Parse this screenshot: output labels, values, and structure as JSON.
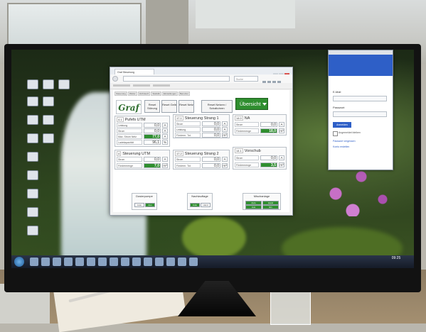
{
  "browser": {
    "tab_title": "Graf Steuerung",
    "url": "",
    "search_placeholder": "Suche"
  },
  "app": {
    "subnav": [
      "Steuerung",
      "Wetter",
      "Verbrauch",
      "Statistik",
      "Einstellungen",
      "Benutzer"
    ],
    "logo": "Graf",
    "header_buttons": [
      {
        "label": "Reset Störung"
      },
      {
        "label": "Reset Gelb"
      },
      {
        "label": "Reset Netz"
      },
      {
        "label": "Reset Netzen / Schaltuhren"
      }
    ],
    "overview_label": "Übersicht",
    "panels": [
      {
        "num": "4.1",
        "title": "Pufefs UTM",
        "rows": [
          {
            "label": "Leistung",
            "value": "0,0",
            "unit": "A"
          },
          {
            "label": "Strom",
            "value": "0,0",
            "unit": "A"
          },
          {
            "label": "Max. Strom Netz",
            "value": "77,0",
            "unit": "A",
            "green": true
          },
          {
            "label": "Ladekapazität",
            "value": "96,1",
            "unit": "%"
          }
        ]
      },
      {
        "num": "17.1",
        "title": "Steuerung Strang 1",
        "rows": [
          {
            "label": "Strom",
            "value": "0,0",
            "unit": "A"
          },
          {
            "label": "Leistung",
            "value": "0,0",
            "unit": "A"
          },
          {
            "label": "Förderm. Tot.",
            "value": "0,0",
            "unit": "m³"
          }
        ]
      },
      {
        "num": "14.0",
        "title": "NA",
        "rows": [
          {
            "label": "Strom",
            "value": "0,0",
            "unit": "A"
          },
          {
            "label": "Fördermenge",
            "value": "18,0",
            "unit": "m³",
            "green": true
          }
        ]
      },
      {
        "num": "4",
        "title": "Steuerung UTM",
        "rows": [
          {
            "label": "Strom",
            "value": "0,0",
            "unit": "A"
          },
          {
            "label": "Fördermenge",
            "value": "7,0",
            "unit": "m³",
            "green": true
          }
        ]
      },
      {
        "num": "17.2",
        "title": "Steuerung Strang 2",
        "rows": [
          {
            "label": "Strom",
            "value": "0,0",
            "unit": "A"
          },
          {
            "label": "Förderm. Tot.",
            "value": "0,0",
            "unit": "m³"
          }
        ]
      },
      {
        "num": "14.1",
        "title": "Vorschub",
        "rows": [
          {
            "label": "Strom",
            "value": "0,0",
            "unit": "A"
          },
          {
            "label": "Fördermenge",
            "value": "3,5",
            "unit": "m³",
            "green": true
          }
        ]
      }
    ],
    "bottom_panels": [
      {
        "title": "Dosierpumpe",
        "items": [
          "Auto",
          "Aus"
        ]
      },
      {
        "title": "Nachlauftage",
        "items": [
          "Auto",
          "Hand"
        ]
      },
      {
        "title": "Mischanlage",
        "items": [
          "Auto",
          "Hand",
          "Aus",
          "Ein"
        ]
      }
    ]
  },
  "login": {
    "email_label": "E-Mail",
    "email_value": "",
    "password_label": "Passwort",
    "password_value": "",
    "submit_label": "Anmelden",
    "remember_label": "Angemeldet bleiben",
    "link_1": "Passwort vergessen",
    "link_2": "Konto erstellen"
  },
  "taskbar": {
    "time": "09:25",
    "date": ""
  },
  "colors": {
    "accent_green": "#2f8e2f",
    "login_blue": "#2e5fc7"
  }
}
